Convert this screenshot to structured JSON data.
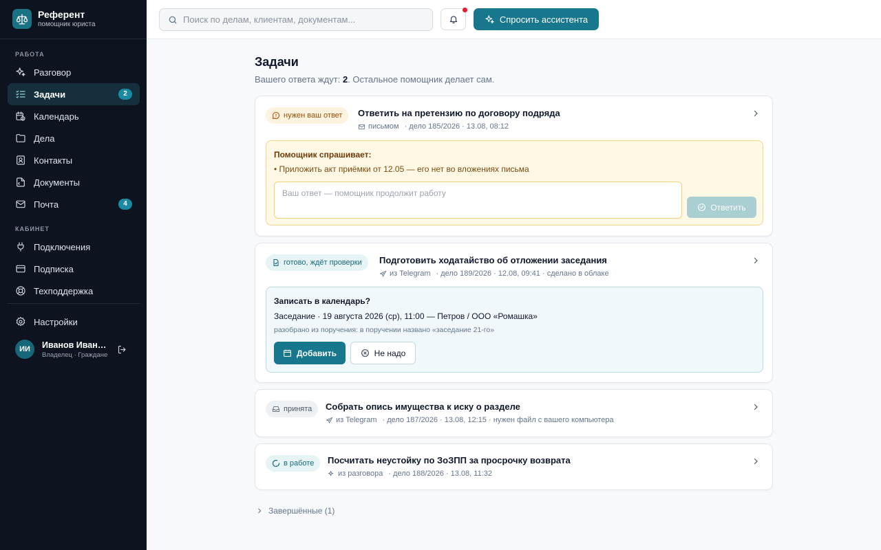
{
  "brand": {
    "title": "Референт",
    "subtitle": "помощник юриста"
  },
  "sidebar": {
    "sections": [
      "РАБОТА",
      "КАБИНЕТ"
    ],
    "work_items": [
      {
        "label": "Разговор",
        "icon": "sparkles-icon"
      },
      {
        "label": "Задачи",
        "icon": "tasks-icon",
        "badge": "2",
        "active": true
      },
      {
        "label": "Календарь",
        "icon": "calendar-clock-icon"
      },
      {
        "label": "Дела",
        "icon": "folder-icon"
      },
      {
        "label": "Контакты",
        "icon": "contact-icon"
      },
      {
        "label": "Документы",
        "icon": "document-icon"
      },
      {
        "label": "Почта",
        "icon": "mail-icon",
        "badge": "4"
      }
    ],
    "cabinet_items": [
      {
        "label": "Подключения",
        "icon": "plug-icon"
      },
      {
        "label": "Подписка",
        "icon": "credit-card-icon"
      },
      {
        "label": "Техподдержка",
        "icon": "lifebuoy-icon"
      }
    ],
    "settings_label": "Настройки",
    "user": {
      "initials": "ИИ",
      "name": "Иванов Иван Иванович",
      "role": "Владелец · Граждане"
    }
  },
  "topbar": {
    "search_placeholder": "Поиск по делам, клиентам, документам...",
    "ask_label": "Спросить ассистента"
  },
  "main": {
    "title": "Задачи",
    "subtitle_prefix": "Вашего ответа ждут:",
    "subtitle_count": "2",
    "subtitle_suffix": ". Остальное помощник делает сам.",
    "tasks": [
      {
        "status": "нужен ваш ответ",
        "title": "Ответить на претензию по договору подряда",
        "source": "письмом",
        "meta": "· дело 185/2026 · 13.08, 08:12",
        "question_head": "Помощник спрашивает:",
        "question": "• Приложить акт приёмки от 12.05 — его нет во вложениях письма",
        "reply_placeholder": "Ваш ответ — помощник продолжит работу",
        "reply_label": "Ответить"
      },
      {
        "status": "готово, ждёт проверки",
        "title": "Подготовить ходатайство об отложении заседания",
        "source": "из Telegram",
        "meta": "· дело 189/2026 · 12.08, 09:41 · сделано в облаке",
        "cal_head": "Записать в календарь?",
        "cal_event": "Заседание · 19 августа 2026 (ср), 11:00 — Петров / ООО «Ромашка»",
        "cal_note": "разобрано из поручения: в поручении названо «заседание 21-го»",
        "add_label": "Добавить",
        "no_label": "Не надо"
      },
      {
        "status": "принята",
        "title": "Собрать опись имущества к иску о разделе",
        "source": "из Telegram",
        "meta": "· дело 187/2026 · 13.08, 12:15 · нужен файл с вашего компьютера"
      },
      {
        "status": "в работе",
        "title": "Посчитать неустойку по ЗоЗПП за просрочку возврата",
        "source": "из разговора",
        "meta": "· дело 188/2026 · 13.08, 11:32"
      }
    ],
    "completed_label": "Завершённые (1)"
  },
  "colors": {
    "sidebar_bg": "#0d1420",
    "accent": "#17778c",
    "alert_dot": "#e11d2e",
    "ask_box": "#fef8e5"
  }
}
